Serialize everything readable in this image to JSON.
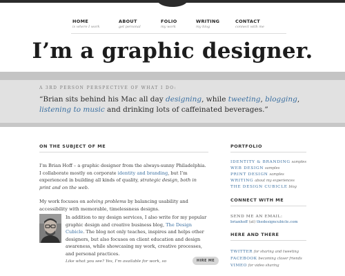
{
  "nav": [
    {
      "label": "HOME",
      "sub": "is where I work"
    },
    {
      "label": "ABOUT",
      "sub": "get personal"
    },
    {
      "label": "FOLIO",
      "sub": "my work"
    },
    {
      "label": "WRITING",
      "sub": "my blog"
    },
    {
      "label": "CONTACT",
      "sub": "connect with me"
    }
  ],
  "hero": {
    "title": "I’m a graphic designer."
  },
  "band": {
    "eyebrow": "A 3RD PERSON PERSPECTIVE OF WHAT I DO:",
    "t1": "“Brian sits behind his Mac all day ",
    "l1": "designing",
    "t2": ", while ",
    "l2": "tweeting",
    "t3": ", ",
    "l3": "blogging",
    "t4": ", ",
    "l4": "listening to music",
    "t5": " and drinking lots of caffeinated beverages.”"
  },
  "main": {
    "title": "ON THE SUBJECT OF ME",
    "p1a": "I’m Brian Hoff – a graphic designer from the always-sunny Philadelphia. I collaborate mostly on corporate ",
    "p1link": "identity and branding",
    "p1b": ", but I’m experienced in building all kinds of quality, ",
    "p1em": "strategic design, both in print and on the web.",
    "p2a": "My work focuses on ",
    "p2em": "solving problems",
    "p2b": " by balancing usability and accessibility with memorable, timelessness designs.",
    "p3a": "In addition to my design services, I also write for my popular graphic design and creative business blog, ",
    "p3link": "The Design Cubicle",
    "p3b": ". The blog not only teaches, inspires and helps other designers, but also focuses on client education and design awareness, while showcasing my work, creative processes, and personal practices.",
    "hire_text": "Like what you see? Yes, I’m available for work, so",
    "hire_button": "HIRE ME"
  },
  "side": {
    "portfolio_title": "PORTFOLIO",
    "portfolio": [
      {
        "name": "IDENTITY & BRANDING",
        "desc": "samples"
      },
      {
        "name": "WEB DESIGN",
        "desc": "samples"
      },
      {
        "name": "PRINT DESIGN",
        "desc": "samples"
      },
      {
        "name": "WRITING",
        "desc": "about my experiences"
      },
      {
        "name": "THE DESIGN CUBICLE",
        "desc": "blog"
      }
    ],
    "connect_title": "CONNECT WITH ME",
    "email_label": "SEND ME AN EMAIL:",
    "email_a": "brianhoff",
    "email_at": " (at) ",
    "email_b": "thedesigncubicle.com",
    "here_title": "HERE AND THERE",
    "here": [
      {
        "name": "TWITTER",
        "desc": "for sharing and tweeting"
      },
      {
        "name": "FACEBOOK",
        "desc": "becoming closer friends"
      },
      {
        "name": "VIMEO",
        "desc": "for video sharing"
      }
    ]
  }
}
